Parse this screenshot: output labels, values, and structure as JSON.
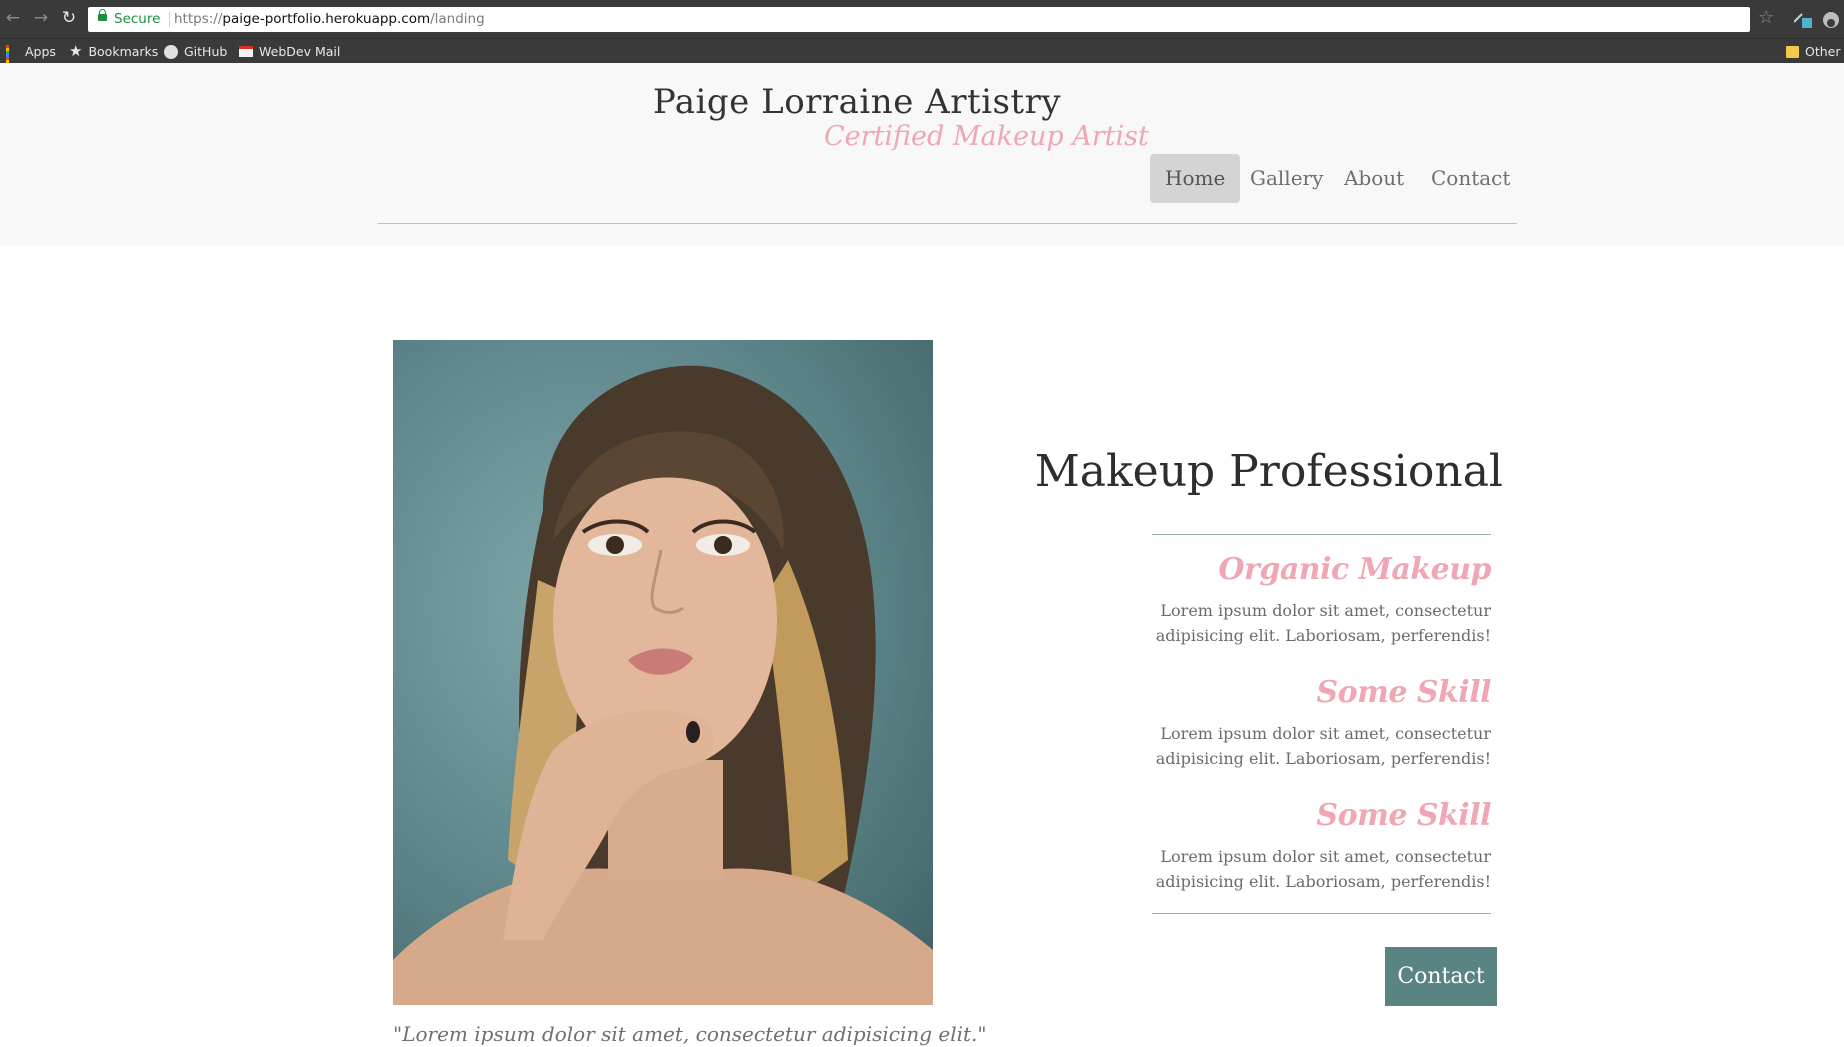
{
  "browser": {
    "secure_label": "Secure",
    "url_scheme": "https://",
    "url_host": "paige-portfolio.herokuapp.com",
    "url_path": "/landing",
    "bookmarks": [
      "Apps",
      "Bookmarks",
      "GitHub",
      "WebDev Mail"
    ],
    "other_bookmarks": "Other"
  },
  "header": {
    "title": "Paige Lorraine Artistry",
    "subtitle": "Certified Makeup Artist",
    "nav": [
      "Home",
      "Gallery",
      "About",
      "Contact"
    ],
    "active_nav": "Home"
  },
  "hero": {
    "quote": "\"Lorem ipsum dolor sit amet, consectetur adipisicing elit.\""
  },
  "intro": {
    "headline": "Makeup Professional",
    "skills": [
      {
        "title": "Organic Makeup",
        "desc_line1": "Lorem ipsum dolor sit amet, consectetur",
        "desc_line2": "adipisicing elit. Laboriosam, perferendis!"
      },
      {
        "title": "Some Skill",
        "desc_line1": "Lorem ipsum dolor sit amet, consectetur",
        "desc_line2": "adipisicing elit. Laboriosam, perferendis!"
      },
      {
        "title": "Some Skill",
        "desc_line1": "Lorem ipsum dolor sit amet, consectetur",
        "desc_line2": "adipisicing elit. Laboriosam, perferendis!"
      }
    ],
    "contact_button": "Contact"
  },
  "colors": {
    "accent_pink": "#f0a6b3",
    "teal": "#5a8383",
    "header_bg": "#f8f8f8"
  }
}
